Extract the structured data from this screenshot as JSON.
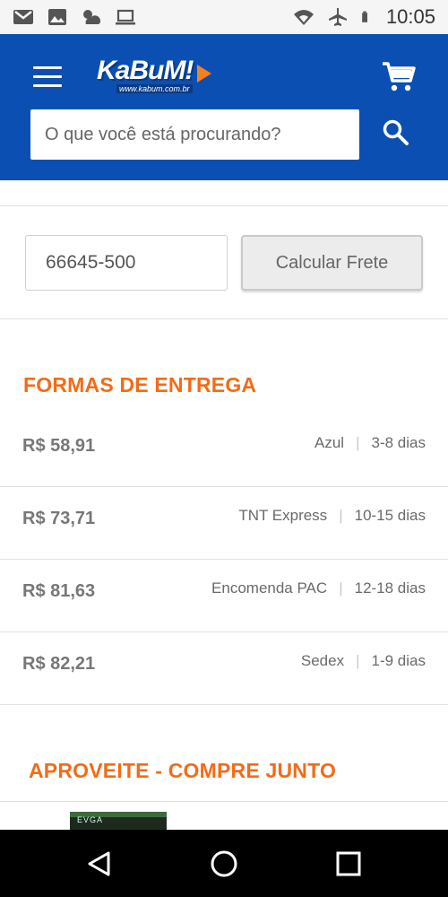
{
  "status_bar": {
    "time": "10:05",
    "left_icons": [
      "gmail-icon",
      "image-icon",
      "weather-icon",
      "laptop-icon"
    ],
    "right_icons": [
      "wifi-icon",
      "airplane-icon",
      "battery-icon"
    ]
  },
  "header": {
    "logo_text": "KaBuM!",
    "logo_url": "www.kabum.com.br",
    "search_placeholder": "O que você está procurando?",
    "brand_color": "#0b4fb3"
  },
  "shipping_calc": {
    "cep_value": "66645-500",
    "button_label": "Calcular Frete"
  },
  "delivery": {
    "title": "FORMAS DE ENTREGA",
    "accent_color": "#f36b17",
    "options": [
      {
        "price": "R$ 58,91",
        "method": "Azul",
        "time": "3-8 dias"
      },
      {
        "price": "R$ 73,71",
        "method": "TNT Express",
        "time": "10-15 dias"
      },
      {
        "price": "R$ 81,63",
        "method": "Encomenda PAC",
        "time": "12-18 dias"
      },
      {
        "price": "R$ 82,21",
        "method": "Sedex",
        "time": "1-9 dias"
      }
    ]
  },
  "combo": {
    "title": "APROVEITE - COMPRE JUNTO",
    "thumb_label": "EVGA"
  },
  "nav": {
    "buttons": [
      "back-icon",
      "home-icon",
      "recents-icon"
    ]
  }
}
